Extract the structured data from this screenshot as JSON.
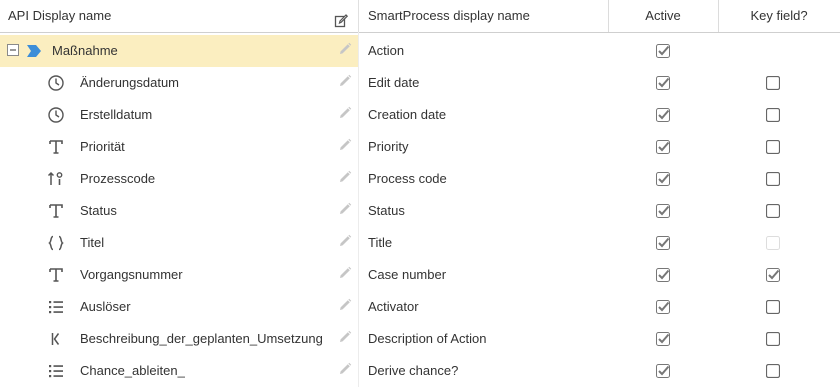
{
  "header": {
    "api_display_name": "API Display name",
    "smartprocess_display_name": "SmartProcess display name",
    "active": "Active",
    "key_field": "Key field?"
  },
  "rows": [
    {
      "api": "Maßnahme",
      "sp": "Action",
      "icon": "process-tag-icon",
      "active": true,
      "key": null,
      "selected": true
    },
    {
      "api": "Änderungsdatum",
      "sp": "Edit date",
      "icon": "clock-icon",
      "active": true,
      "key": false
    },
    {
      "api": "Erstelldatum",
      "sp": "Creation date",
      "icon": "clock-icon",
      "active": true,
      "key": false
    },
    {
      "api": "Priorität",
      "sp": "Priority",
      "icon": "text-type-icon",
      "active": true,
      "key": false
    },
    {
      "api": "Prozesscode",
      "sp": "Process code",
      "icon": "sort-code-icon",
      "active": true,
      "key": false
    },
    {
      "api": "Status",
      "sp": "Status",
      "icon": "text-type-icon",
      "active": true,
      "key": false
    },
    {
      "api": "Titel",
      "sp": "Title",
      "icon": "braces-icon",
      "active": true,
      "key": "disabled"
    },
    {
      "api": "Vorgangsnummer",
      "sp": "Case number",
      "icon": "text-type-icon",
      "active": true,
      "key": true
    },
    {
      "api": "Auslöser",
      "sp": "Activator",
      "icon": "list-icon",
      "active": true,
      "key": false
    },
    {
      "api": "Beschreibung_der_geplanten_Umsetzung",
      "sp": "Description of Action",
      "icon": "rich-text-icon",
      "active": true,
      "key": false
    },
    {
      "api": "Chance_ableiten_",
      "sp": "Derive chance?",
      "icon": "list-icon",
      "active": true,
      "key": false
    }
  ]
}
